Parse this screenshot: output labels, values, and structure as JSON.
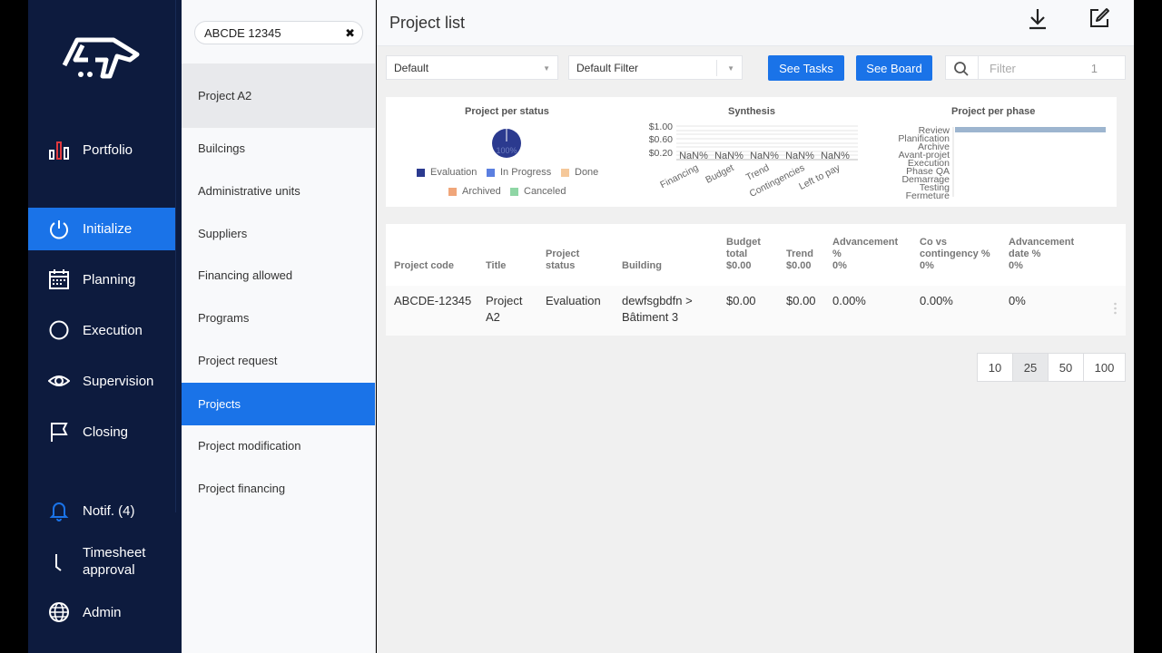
{
  "nav": {
    "items": [
      {
        "label": "Portfolio",
        "icon": "bar-chart-icon"
      },
      {
        "label": "Initialize",
        "icon": "power-icon"
      },
      {
        "label": "Planning",
        "icon": "calendar-icon"
      },
      {
        "label": "Execution",
        "icon": "circle-progress-icon"
      },
      {
        "label": "Supervision",
        "icon": "eye-icon"
      },
      {
        "label": "Closing",
        "icon": "flag-icon"
      },
      {
        "label": "Notif. (4)",
        "icon": "bell-icon"
      },
      {
        "label_line1": "Timesheet",
        "label_line2": "approval",
        "icon": "timesheet-icon"
      },
      {
        "label": "Admin",
        "icon": "globe-icon"
      }
    ],
    "active": "Initialize",
    "accent": "#1a73e8",
    "background": "#0d1b3e"
  },
  "subnav": {
    "search_value": "ABCDE 12345",
    "current_project": "Project A2",
    "items": [
      "Builcings",
      "Administrative units",
      "Suppliers",
      "Financing allowed",
      "Programs",
      "Project request",
      "Projects",
      "Project modification",
      "Project financing"
    ],
    "active": "Projects"
  },
  "header": {
    "title": "Project list"
  },
  "toolbar": {
    "view_select": "Default",
    "filter_select": "Default Filter",
    "see_tasks": "See Tasks",
    "see_board": "See Board",
    "filter_placeholder": "Filter",
    "filter_count": "1"
  },
  "charts": {
    "status": {
      "title": "Project per status",
      "center_label": "100%",
      "legend": [
        {
          "name": "Evaluation",
          "color": "#2b3a8f"
        },
        {
          "name": "In Progress",
          "color": "#5b7fe0"
        },
        {
          "name": "Done",
          "color": "#f5c89a"
        },
        {
          "name": "Archived",
          "color": "#f0a67a"
        },
        {
          "name": "Canceled",
          "color": "#8fd6a5"
        }
      ]
    },
    "synthesis": {
      "title": "Synthesis",
      "yticks": [
        "$1.00",
        "$0.60",
        "$0.20"
      ],
      "value_labels": [
        "NaN%",
        "NaN%",
        "NaN%",
        "NaN%",
        "NaN%"
      ],
      "categories": [
        "Financing",
        "Budget",
        "Trend",
        "Contingencies",
        "Left to pay"
      ]
    },
    "phase": {
      "title": "Project per phase",
      "categories": [
        "Review",
        "Planification",
        "Archive",
        "Avant-projet",
        "Execution",
        "Phase QA",
        "Demarrage",
        "Testing",
        "Fermeture"
      ]
    }
  },
  "chart_data": [
    {
      "type": "pie",
      "title": "Project per status",
      "categories": [
        "Evaluation",
        "In Progress",
        "Done",
        "Archived",
        "Canceled"
      ],
      "values": [
        100,
        0,
        0,
        0,
        0
      ],
      "legend": "bottom"
    },
    {
      "type": "bar",
      "title": "Synthesis",
      "categories": [
        "Financing",
        "Budget",
        "Trend",
        "Contingencies",
        "Left to pay"
      ],
      "values": [
        0,
        0,
        0,
        0,
        0
      ],
      "yticks": [
        "$1.00",
        "$0.60",
        "$0.20"
      ],
      "data_labels": [
        "NaN%",
        "NaN%",
        "NaN%",
        "NaN%",
        "NaN%"
      ]
    },
    {
      "type": "bar",
      "title": "Project per phase",
      "orientation": "horizontal",
      "categories": [
        "Review",
        "Planification",
        "Archive",
        "Avant-projet",
        "Execution",
        "Phase QA",
        "Demarrage",
        "Testing",
        "Fermeture"
      ],
      "values": [
        1,
        0,
        0,
        0,
        0,
        0,
        0,
        0,
        0
      ]
    }
  ],
  "table": {
    "headers": {
      "code": "Project code",
      "title": "Title",
      "status": [
        "Project",
        "status"
      ],
      "building": "Building",
      "budget": [
        "Budget",
        "total",
        "$0.00"
      ],
      "trend": [
        "Trend",
        "$0.00"
      ],
      "advancement": [
        "Advancement",
        "%",
        "0%"
      ],
      "contingency": [
        "Co vs",
        "contingency %",
        "0%"
      ],
      "adv_date": [
        "Advancement",
        "date %",
        "0%"
      ]
    },
    "rows": [
      {
        "code": "ABCDE-12345",
        "title": [
          "Project",
          "A2"
        ],
        "status": "Evaluation",
        "building": [
          "dewfsgbdfn >",
          "Bâtiment 3"
        ],
        "budget": "$0.00",
        "trend": "$0.00",
        "advancement": "0.00%",
        "contingency": "0.00%",
        "adv_date": "0%"
      }
    ]
  },
  "pagination": {
    "sizes": [
      "10",
      "25",
      "50",
      "100"
    ],
    "active": "25"
  }
}
